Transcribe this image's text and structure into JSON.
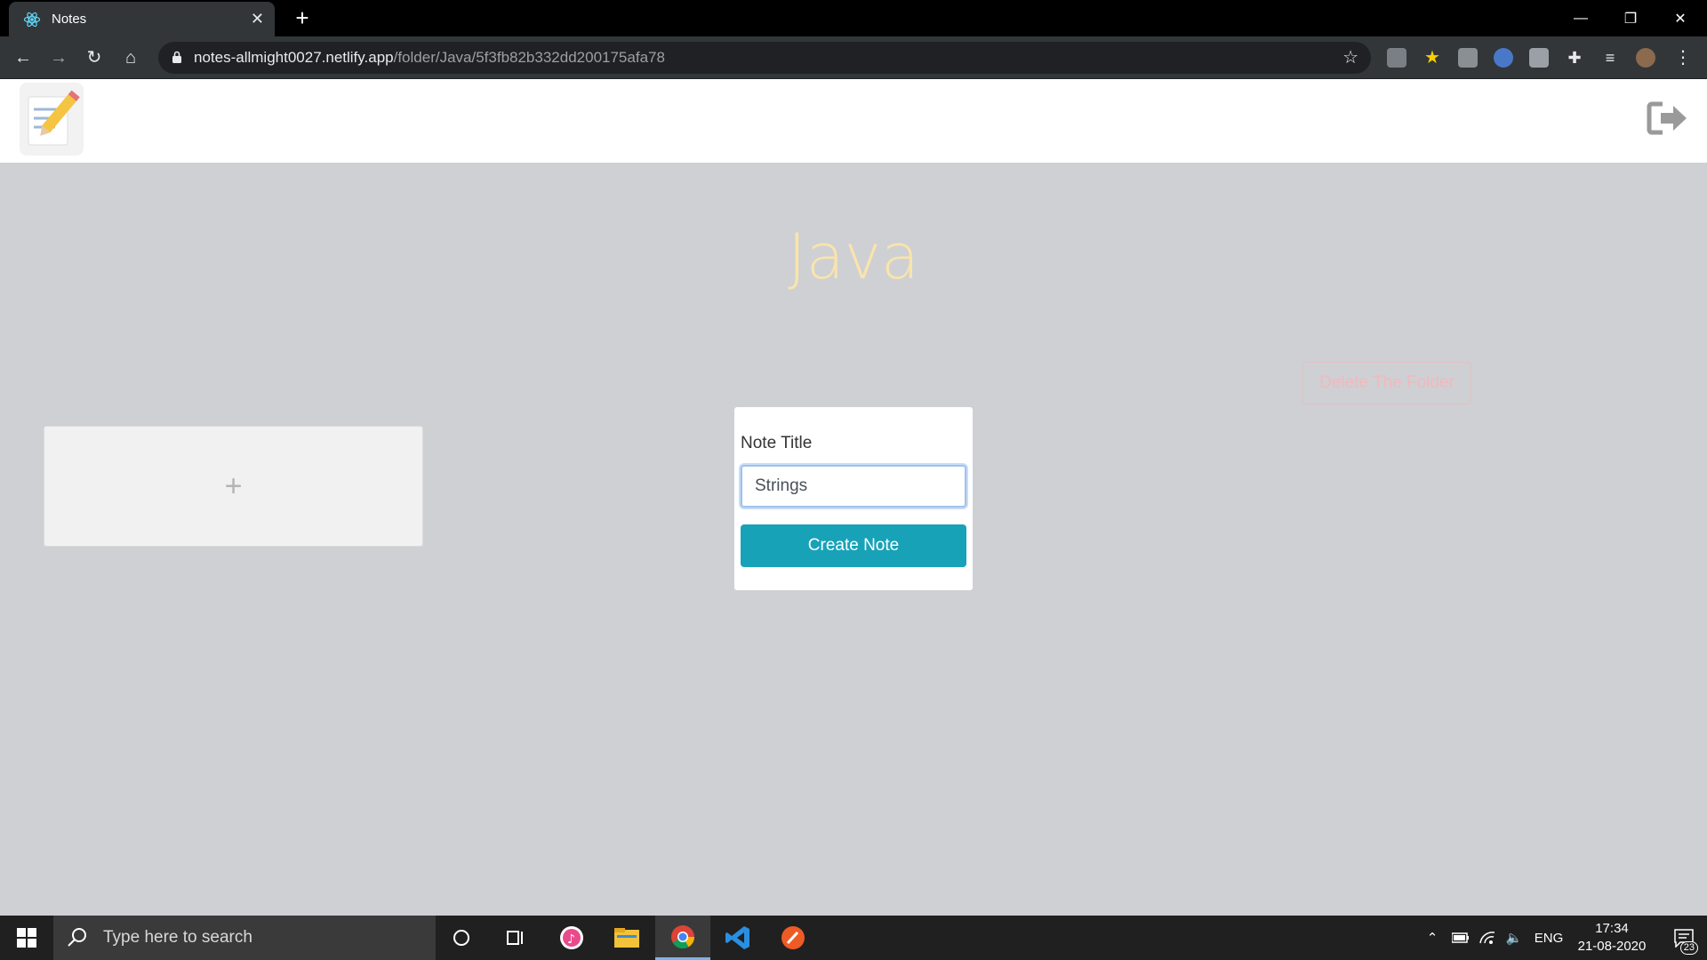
{
  "browser": {
    "tab_title": "Notes",
    "tab_close": "✕",
    "new_tab": "+",
    "url_host": "notes-allmight0027.netlify.app",
    "url_path": "/folder/Java/5f3fb82b332dd200175afa78",
    "window_controls": [
      "—",
      "❐",
      "✕"
    ]
  },
  "header": {
    "logo_icon": "notepad-pencil-icon",
    "logout_icon": "logout-icon"
  },
  "folder": {
    "title": "Java",
    "delete_label": "Delete The Folder"
  },
  "add_note": {
    "plus": "+"
  },
  "note_form": {
    "label": "Note Title",
    "title_value": "Strings",
    "create_label": "Create Note"
  },
  "taskbar": {
    "search_placeholder": "Type here to search",
    "language": "ENG",
    "time": "17:34",
    "date": "21-08-2020",
    "notification_count": "23"
  },
  "colors": {
    "page_bg": "#ced0d3",
    "folder_title": "#f9e4ab",
    "create_button": "#18a2b8",
    "delete_button_text": "#f0b9bf"
  }
}
